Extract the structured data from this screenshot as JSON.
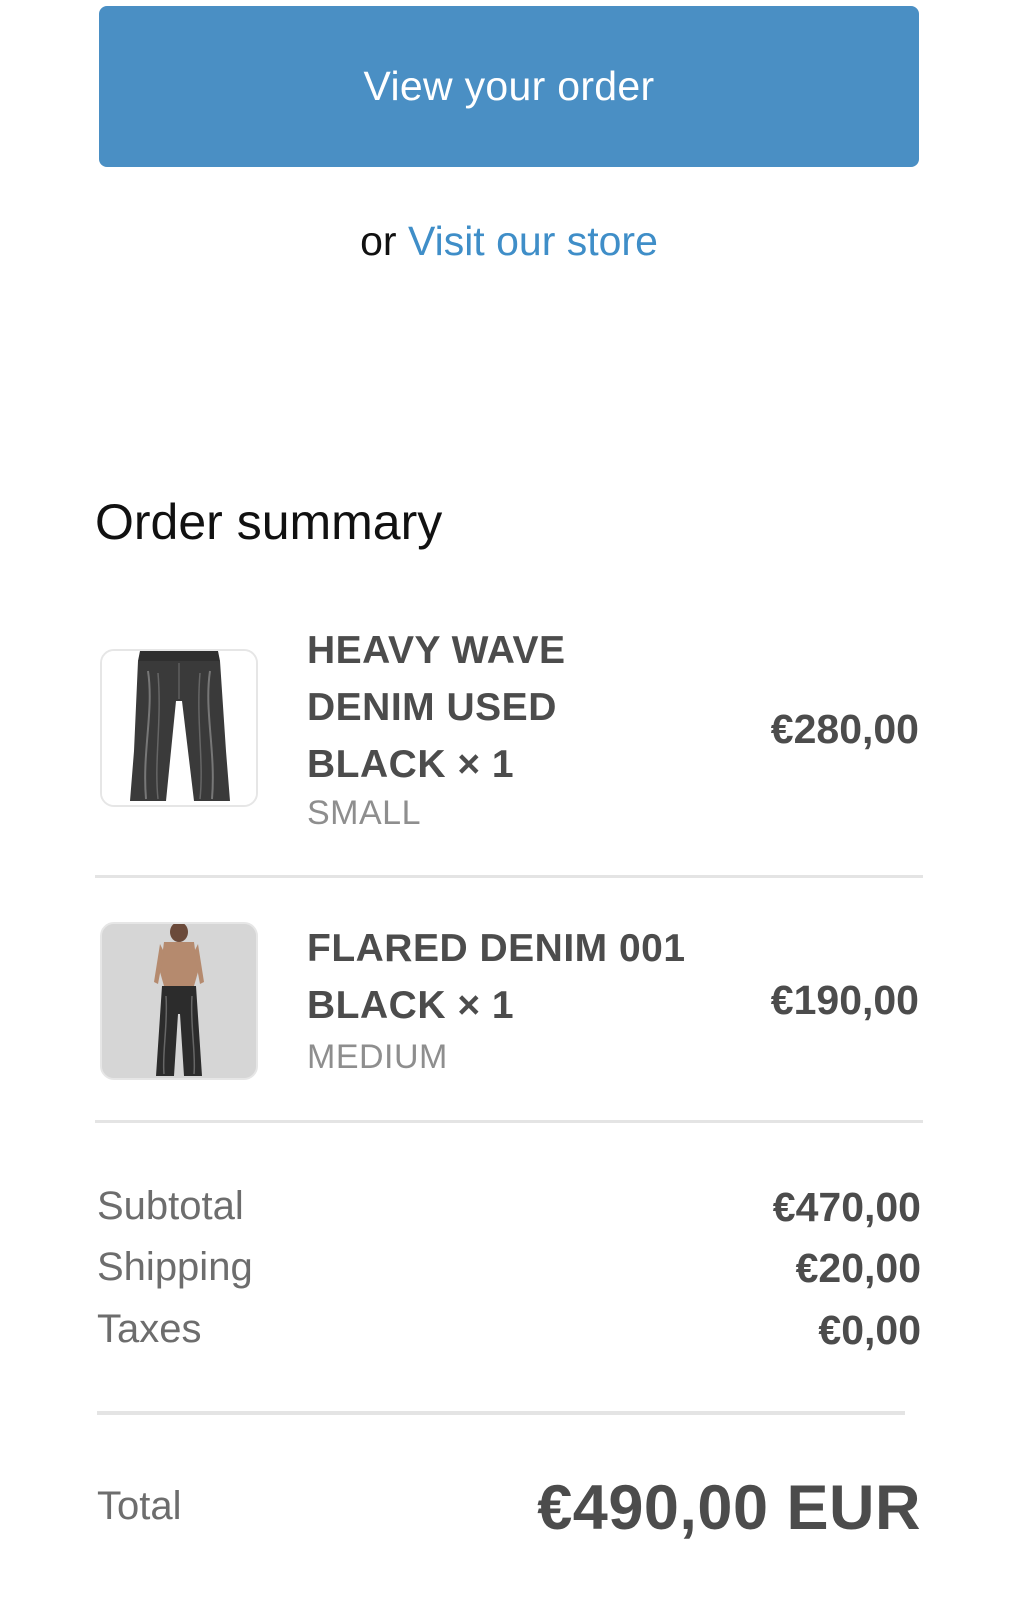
{
  "actions": {
    "view_order_label": "View your order",
    "or_text": "or",
    "visit_store_label": "Visit our store"
  },
  "summary": {
    "title": "Order summary",
    "items": [
      {
        "title_lines": [
          "HEAVY WAVE",
          "DENIM USED",
          "BLACK × 1"
        ],
        "variant": "SMALL",
        "price": "€280,00",
        "image": "black-wide-leg-jeans"
      },
      {
        "title_lines": [
          "FLARED DENIM 001",
          "BLACK × 1"
        ],
        "variant": "MEDIUM",
        "price": "€190,00",
        "image": "model-wearing-black-flared-jeans"
      }
    ],
    "costs": {
      "subtotal_label": "Subtotal",
      "subtotal_value": "€470,00",
      "shipping_label": "Shipping",
      "shipping_value": "€20,00",
      "taxes_label": "Taxes",
      "taxes_value": "€0,00"
    },
    "total_label": "Total",
    "total_value": "€490,00 EUR"
  },
  "colors": {
    "accent": "#4a8fc4",
    "link": "#3f8ec8",
    "text_strong": "#4c4c4c",
    "text_muted": "#6d6d6d"
  }
}
